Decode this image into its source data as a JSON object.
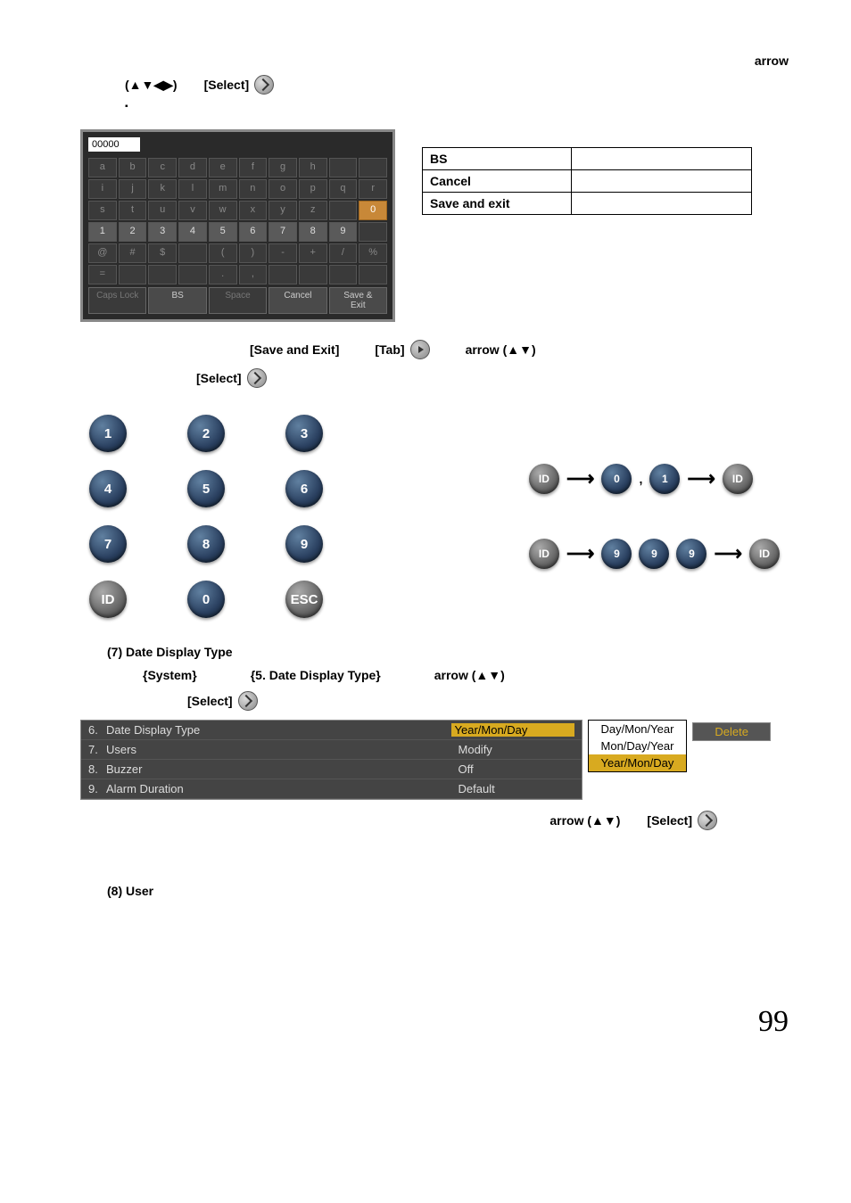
{
  "top_right": "arrow",
  "arrows_symbols": "(▲▼◀▶)",
  "select_label": "[Select]",
  "bullet": "▪",
  "vk": {
    "input_value": "00000",
    "rows": [
      [
        "a",
        "b",
        "c",
        "d",
        "e",
        "f",
        "g",
        "h",
        "",
        ""
      ],
      [
        "i",
        "j",
        "k",
        "l",
        "m",
        "n",
        "o",
        "p",
        "q",
        "r"
      ],
      [
        "s",
        "t",
        "u",
        "v",
        "w",
        "x",
        "y",
        "z",
        "",
        "0"
      ],
      [
        "1",
        "2",
        "3",
        "4",
        "5",
        "6",
        "7",
        "8",
        "9",
        ""
      ],
      [
        "@",
        "#",
        "$",
        "",
        "(",
        ")",
        "-",
        "+",
        "/",
        "%"
      ],
      [
        "=",
        "",
        "",
        "",
        ".",
        ",",
        "",
        "",
        "",
        ""
      ]
    ],
    "bottom": [
      "Caps Lock",
      "BS",
      "Space",
      "Cancel",
      "Save & Exit"
    ]
  },
  "legend": {
    "r1": "BS",
    "r2": "Cancel",
    "r3": "Save and exit"
  },
  "save_exit": "[Save and Exit]",
  "tab": "[Tab]",
  "arrow_ud": "arrow (▲▼)",
  "keypad": {
    "keys": [
      "1",
      "2",
      "3",
      "4",
      "5",
      "6",
      "7",
      "8",
      "9",
      "ID",
      "0",
      "ESC"
    ]
  },
  "id_flow_top": {
    "id": "ID",
    "seq": [
      "0",
      "1"
    ],
    "id2": "ID"
  },
  "id_flow_bot": {
    "id": "ID",
    "seq": [
      "9",
      "9",
      "9"
    ],
    "id2": "ID"
  },
  "sec7": {
    "title": "(7) Date Display Type",
    "system": "{System}",
    "menu": "{5. Date Display Type}",
    "arrow": "arrow (▲▼)"
  },
  "syslist": [
    {
      "num": "6.",
      "label": "Date Display Type",
      "val": "Year/Mon/Day",
      "hl": true
    },
    {
      "num": "7.",
      "label": "Users",
      "val": "Modify",
      "hl": false
    },
    {
      "num": "8.",
      "label": "Buzzer",
      "val": "Off",
      "hl": false
    },
    {
      "num": "9.",
      "label": "Alarm Duration",
      "val": "Default",
      "hl": false
    }
  ],
  "dropdown": {
    "opts": [
      "Day/Mon/Year",
      "Mon/Day/Year",
      "Year/Mon/Day"
    ],
    "selected": 2,
    "delete": "Delete"
  },
  "post": {
    "arrow": "arrow (▲▼)",
    "select": "[Select]"
  },
  "sec8": "(8) User",
  "page": "99"
}
